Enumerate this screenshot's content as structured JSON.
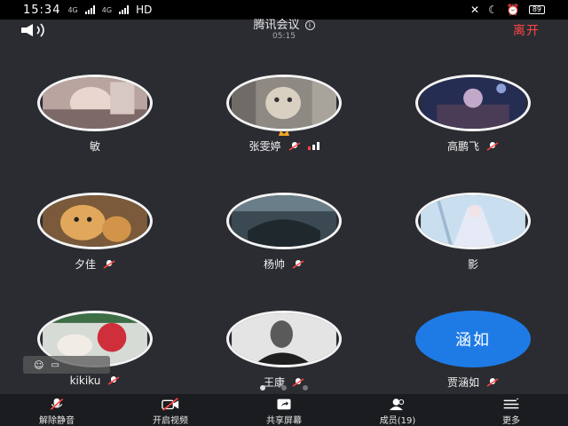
{
  "status_bar": {
    "time": "15:34",
    "network_left": "4G",
    "network_right": "4G",
    "hd_label": "HD",
    "battery": "89"
  },
  "header": {
    "title": "腾讯会议",
    "timer": "05:15",
    "leave_label": "离开"
  },
  "participants": [
    {
      "name": "敏",
      "mic": "none"
    },
    {
      "name": "张雯婷",
      "mic": "active",
      "host": true
    },
    {
      "name": "高鹏飞",
      "mic": "muted"
    },
    {
      "name": "夕佳",
      "mic": "muted"
    },
    {
      "name": "杨帅",
      "mic": "muted"
    },
    {
      "name": "影",
      "mic": "none"
    },
    {
      "name": "kikiku",
      "mic": "muted"
    },
    {
      "name": "王康",
      "mic": "muted"
    },
    {
      "name": "贾涵如",
      "mic": "muted",
      "avatar_text": "涵如"
    }
  ],
  "pager": {
    "pages": 3,
    "current": 1
  },
  "toolbar": {
    "unmute": "解除静音",
    "video": "开启视频",
    "share": "共享屏幕",
    "members": "成员(19)",
    "more": "更多"
  },
  "colors": {
    "background": "#2b2c31",
    "leave": "#ff4545",
    "avatar_badge": "#1e7be6",
    "toolbar": "#1b1c20"
  }
}
